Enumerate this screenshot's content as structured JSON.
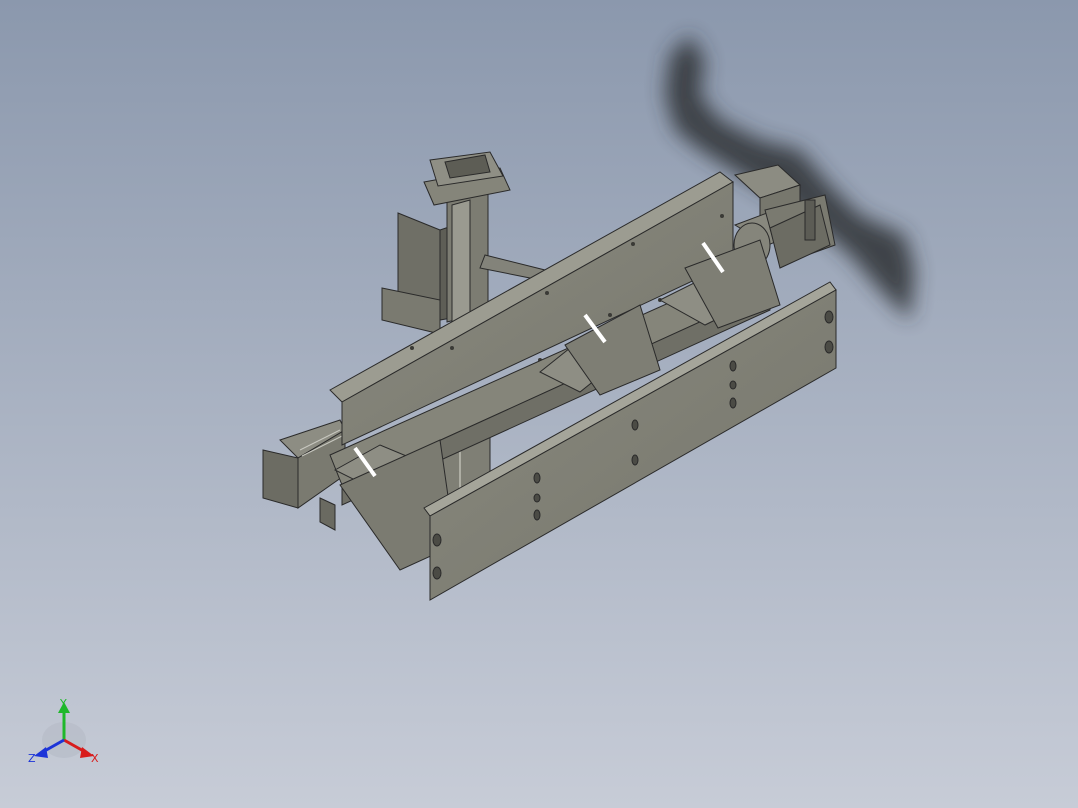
{
  "viewport": {
    "background_top": "#8b98ad",
    "background_bottom": "#c7ccd7"
  },
  "model": {
    "body_color": "#7f7f74",
    "edge_color": "#2a2a2a"
  },
  "triad": {
    "x_label": "X",
    "y_label": "Y",
    "z_label": "Z",
    "x_color": "#d81c1c",
    "y_color": "#1eb82a",
    "z_color": "#1c34d8"
  }
}
